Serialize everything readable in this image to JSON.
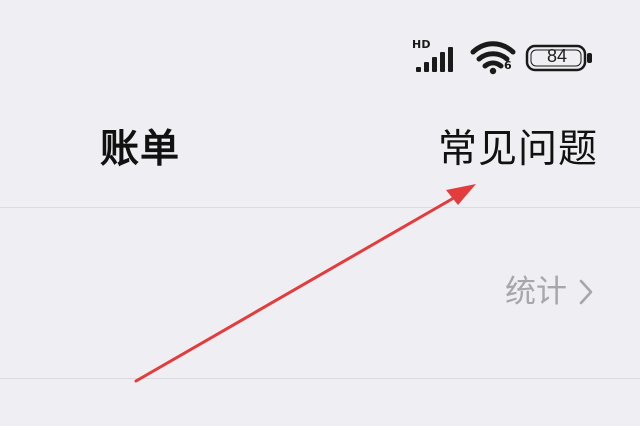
{
  "status_bar": {
    "network_label": "HD",
    "wifi_label": "6",
    "battery_level": "84",
    "icons": {
      "signal": "cellular-signal-icon",
      "wifi": "wifi-icon",
      "battery": "battery-icon"
    }
  },
  "header": {
    "title": "账单",
    "faq_label": "常见问题"
  },
  "content": {
    "stats_label": "统计"
  },
  "annotation": {
    "arrow_color": "#e23c3c"
  },
  "colors": {
    "background": "#efeff3",
    "primary_text": "#111111",
    "secondary_text": "#a6a6ab"
  }
}
